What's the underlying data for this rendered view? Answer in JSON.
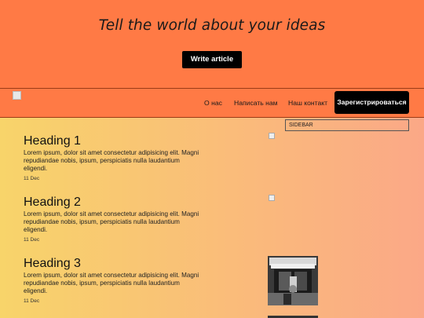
{
  "hero": {
    "title": "Tell the world about your ideas",
    "cta_label": "Write article"
  },
  "nav": {
    "links": [
      {
        "label": "О нас"
      },
      {
        "label": "Написать нам"
      },
      {
        "label": "Наш контакт"
      }
    ],
    "cta_label": "Зарегистрироваться"
  },
  "sidebar": {
    "label": "SIDEBAR"
  },
  "posts": [
    {
      "title": "Heading 1",
      "body": "Lorem ipsum, dolor sit amet consectetur adipisicing elit. Magni repudiandae nobis, ipsum, perspiciatis nulla laudantium eligendi.",
      "date": "11 Dec"
    },
    {
      "title": "Heading 2",
      "body": "Lorem ipsum, dolor sit amet consectetur adipisicing elit. Magni repudiandae nobis, ipsum, perspiciatis nulla laudantium eligendi.",
      "date": "11 Dec"
    },
    {
      "title": "Heading 3",
      "body": "Lorem ipsum, dolor sit amet consectetur adipisicing elit. Magni repudiandae nobis, ipsum, perspiciatis nulla laudantium eligendi.",
      "date": "11 Dec"
    }
  ],
  "colors": {
    "hero_bg": "#ff7a45",
    "gradient_start": "#f8d46a",
    "gradient_end": "#fba887",
    "button_bg": "#000000"
  }
}
